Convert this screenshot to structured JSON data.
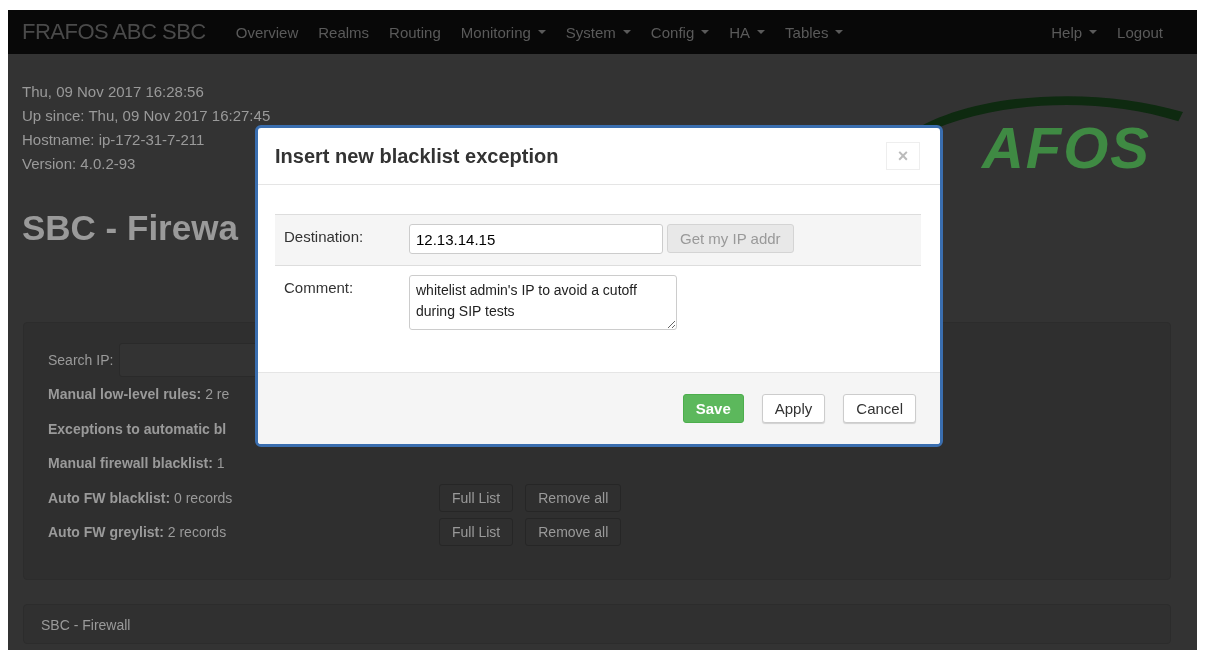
{
  "navbar": {
    "brand": "FRAFOS ABC SBC",
    "items": [
      {
        "label": "Overview",
        "dropdown": false
      },
      {
        "label": "Realms",
        "dropdown": false
      },
      {
        "label": "Routing",
        "dropdown": false
      },
      {
        "label": "Monitoring",
        "dropdown": true
      },
      {
        "label": "System",
        "dropdown": true
      },
      {
        "label": "Config",
        "dropdown": true
      },
      {
        "label": "HA",
        "dropdown": true
      },
      {
        "label": "Tables",
        "dropdown": true
      }
    ],
    "right_items": [
      {
        "label": "Help",
        "dropdown": true
      },
      {
        "label": "Logout",
        "dropdown": false
      }
    ]
  },
  "info": [
    "Thu, 09 Nov 2017 16:28:56",
    "Up since: Thu, 09 Nov 2017 16:27:45",
    "Hostname: ip-172-31-7-211",
    "Version: 4.0.2-93"
  ],
  "logo_text": "AFOS",
  "page_title": "SBC - Firewa",
  "search": {
    "label": "Search IP:"
  },
  "records": [
    {
      "label": "Manual low-level rules:",
      "value": " 2 re"
    },
    {
      "label": "Exceptions to automatic bl"
    },
    {
      "label": "Manual firewall blacklist:",
      "value": " 1"
    },
    {
      "label": "Auto FW blacklist:",
      "value": " 0 records",
      "buttons": [
        "Full List",
        "Remove all"
      ]
    },
    {
      "label": "Auto FW greylist:",
      "value": " 2 records",
      "buttons": [
        "Full List",
        "Remove all"
      ]
    }
  ],
  "breadcrumb": "SBC - Firewall",
  "modal": {
    "title": "Insert new blacklist exception",
    "close": "×",
    "fields": [
      {
        "kind": "input",
        "label": "Destination:",
        "value": "12.13.14.15",
        "button": "Get my IP addr"
      },
      {
        "kind": "textarea",
        "label": "Comment:",
        "value": "whitelist admin's IP to avoid a cutoff during SIP tests"
      }
    ],
    "buttons": [
      {
        "label": "Save",
        "kind": "primary"
      },
      {
        "label": "Apply",
        "kind": "default"
      },
      {
        "label": "Cancel",
        "kind": "default"
      }
    ]
  }
}
